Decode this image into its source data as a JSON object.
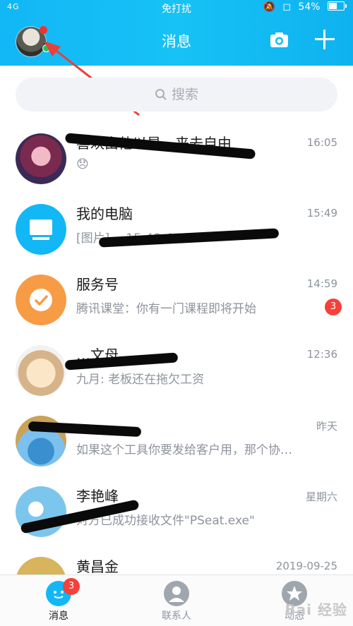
{
  "status_bar": {
    "signal": "4G",
    "center": "免打扰",
    "battery": "54%"
  },
  "header": {
    "title": "消息"
  },
  "search": {
    "placeholder": "搜索"
  },
  "conversations": [
    {
      "name": "喜欢由他以是…来去自由",
      "preview": "😞",
      "time": "16:05",
      "badge": ""
    },
    {
      "name": "我的电脑",
      "preview": "[图片]…-15-48-4…",
      "time": "15:49",
      "badge": ""
    },
    {
      "name": "服务号",
      "preview": "腾讯课堂：你有一门课程即将开始",
      "time": "14:59",
      "badge": "3"
    },
    {
      "name": "…文母",
      "preview": "九月: 老板还在拖欠工资",
      "time": "12:36",
      "badge": ""
    },
    {
      "name": "",
      "preview": "如果这个工具你要发给客户用，那个协…",
      "time": "昨天",
      "badge": ""
    },
    {
      "name": "李艳峰",
      "preview": "对方已成功接收文件\"PSeat.exe\"",
      "time": "星期六",
      "badge": ""
    },
    {
      "name": "黄昌金",
      "preview": "",
      "time": "2019-09-25",
      "badge": ""
    }
  ],
  "bottom_nav": [
    {
      "label": "消息",
      "badge": "3",
      "active": true
    },
    {
      "label": "联系人"
    },
    {
      "label": "动态"
    }
  ],
  "watermark": "Bai 经验",
  "colors": {
    "brand": "#12b7f5",
    "badge": "#f6403a",
    "annotation": "#e8403a"
  }
}
